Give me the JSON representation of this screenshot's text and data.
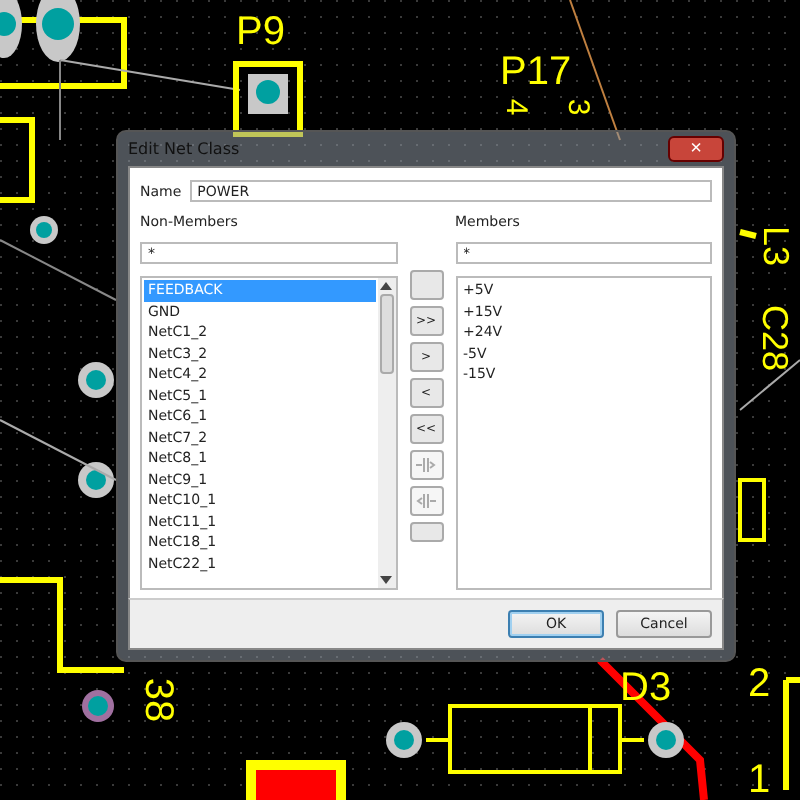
{
  "pcb_labels": [
    {
      "text": "P9"
    },
    {
      "text": "P17"
    },
    {
      "text": "4"
    },
    {
      "text": "3"
    },
    {
      "text": "L3"
    },
    {
      "text": "C28"
    },
    {
      "text": "38"
    },
    {
      "text": "D3"
    },
    {
      "text": "2"
    },
    {
      "text": "1"
    }
  ],
  "dialog": {
    "title": "Edit Net Class",
    "close": "×",
    "name_label": "Name",
    "name_value": "POWER",
    "non_members": {
      "label": "Non-Members",
      "filter": "*",
      "items": [
        {
          "text": "FEEDBACK",
          "selected": true
        },
        {
          "text": "GND",
          "selected": false
        },
        {
          "text": "NetC1_2",
          "selected": false
        },
        {
          "text": "NetC3_2",
          "selected": false
        },
        {
          "text": "NetC4_2",
          "selected": false
        },
        {
          "text": "NetC5_1",
          "selected": false
        },
        {
          "text": "NetC6_1",
          "selected": false
        },
        {
          "text": "NetC7_2",
          "selected": false
        },
        {
          "text": "NetC8_1",
          "selected": false
        },
        {
          "text": "NetC9_1",
          "selected": false
        },
        {
          "text": "NetC10_1",
          "selected": false
        },
        {
          "text": "NetC11_1",
          "selected": false
        },
        {
          "text": "NetC18_1",
          "selected": false
        },
        {
          "text": "NetC22_1",
          "selected": false
        }
      ]
    },
    "transfer_buttons": [
      {
        "kind": "blank"
      },
      {
        "kind": "text",
        "label": ">>",
        "disabled": false
      },
      {
        "kind": "text",
        "label": ">",
        "disabled": false
      },
      {
        "kind": "text",
        "label": "<",
        "disabled": false
      },
      {
        "kind": "text",
        "label": "<<",
        "disabled": false
      },
      {
        "kind": "icon",
        "disabled": true
      },
      {
        "kind": "icon",
        "disabled": true
      },
      {
        "kind": "blank"
      }
    ],
    "members": {
      "label": "Members",
      "filter": "*",
      "items": [
        {
          "text": "+5V",
          "selected": false
        },
        {
          "text": "+15V",
          "selected": false
        },
        {
          "text": "+24V",
          "selected": false
        },
        {
          "text": "-5V",
          "selected": false
        },
        {
          "text": "-15V",
          "selected": false
        }
      ]
    },
    "buttons": [
      {
        "label": "OK",
        "default": true
      },
      {
        "label": "Cancel",
        "default": false
      }
    ]
  }
}
